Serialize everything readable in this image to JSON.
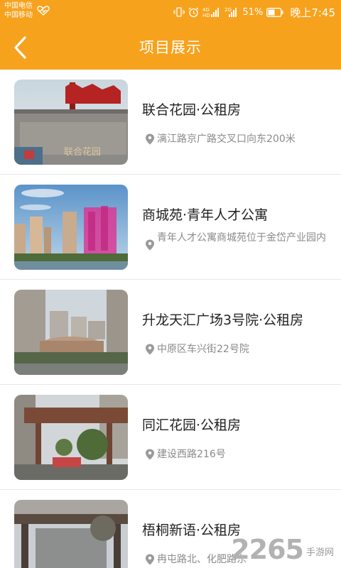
{
  "status_bar": {
    "carrier_1": "中国电信",
    "carrier_2": "中国移动",
    "battery_percent": "51%",
    "time": "晚上7:45"
  },
  "header": {
    "title": "项目展示"
  },
  "projects": [
    {
      "title": "联合花园·公租房",
      "address": "漓江路京广路交叉口向东200米"
    },
    {
      "title": "商城苑·青年人才公寓",
      "address": "青年人才公寓商城苑位于金岱产业园内"
    },
    {
      "title": "升龙天汇广场3号院·公租房",
      "address": "中原区车兴街22号院"
    },
    {
      "title": "同汇花园·公租房",
      "address": "建设西路216号"
    },
    {
      "title": "梧桐新语·公租房",
      "address": "冉屯路北、化肥路东"
    }
  ],
  "watermark": {
    "number": "2265",
    "text": "手游网"
  },
  "colors": {
    "accent": "#f7a21d"
  }
}
